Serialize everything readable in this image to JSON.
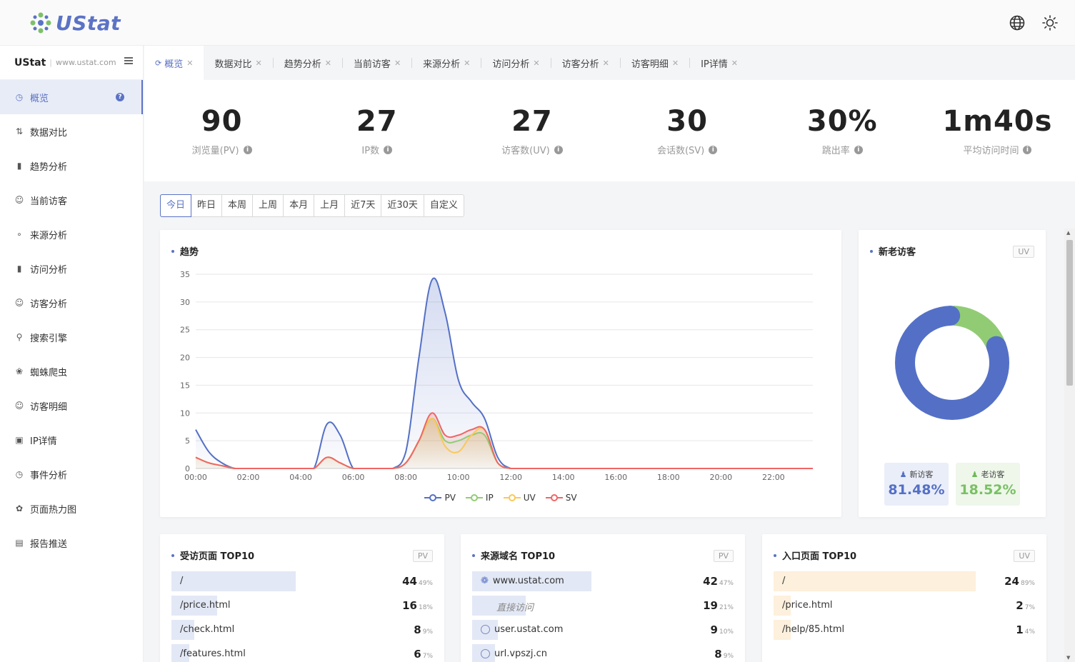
{
  "app": {
    "logo_text": "UStat"
  },
  "site": {
    "name": "UStat",
    "url": "www.ustat.com"
  },
  "sidebar": {
    "items": [
      {
        "label": "概览",
        "icon": "dashboard-icon"
      },
      {
        "label": "数据对比",
        "icon": "compare-icon"
      },
      {
        "label": "趋势分析",
        "icon": "trend-icon"
      },
      {
        "label": "当前访客",
        "icon": "user-icon"
      },
      {
        "label": "来源分析",
        "icon": "share-icon"
      },
      {
        "label": "访问分析",
        "icon": "bar-chart-icon"
      },
      {
        "label": "访客分析",
        "icon": "visitor-icon"
      },
      {
        "label": "搜索引擎",
        "icon": "search-icon"
      },
      {
        "label": "蜘蛛爬虫",
        "icon": "bug-icon"
      },
      {
        "label": "访客明细",
        "icon": "person-detail-icon"
      },
      {
        "label": "IP详情",
        "icon": "ip-icon"
      },
      {
        "label": "事件分析",
        "icon": "clock-icon"
      },
      {
        "label": "页面热力图",
        "icon": "heatmap-icon"
      },
      {
        "label": "报告推送",
        "icon": "report-icon"
      }
    ]
  },
  "tabs": [
    {
      "label": "概览"
    },
    {
      "label": "数据对比"
    },
    {
      "label": "趋势分析"
    },
    {
      "label": "当前访客"
    },
    {
      "label": "来源分析"
    },
    {
      "label": "访问分析"
    },
    {
      "label": "访客分析"
    },
    {
      "label": "访客明细"
    },
    {
      "label": "IP详情"
    }
  ],
  "stats": [
    {
      "value": "90",
      "label": "浏览量(PV)"
    },
    {
      "value": "27",
      "label": "IP数"
    },
    {
      "value": "27",
      "label": "访客数(UV)"
    },
    {
      "value": "30",
      "label": "会话数(SV)"
    },
    {
      "value": "30%",
      "label": "跳出率"
    },
    {
      "value": "1m40s",
      "label": "平均访问时间"
    }
  ],
  "date_range": [
    "今日",
    "昨日",
    "本周",
    "上周",
    "本月",
    "上月",
    "近7天",
    "近30天",
    "自定义"
  ],
  "trend": {
    "title": "趋势"
  },
  "visitors": {
    "title": "新老访客",
    "badge": "UV",
    "new_label": "新访客",
    "new_value": "81.48%",
    "old_label": "老访客",
    "old_value": "18.52%",
    "new_fraction": 0.8148,
    "colors": {
      "new": "#5470c6",
      "old": "#91cc75"
    }
  },
  "chart_data": {
    "type": "line",
    "title": "趋势",
    "x_ticks": [
      "00:00",
      "02:00",
      "04:00",
      "06:00",
      "08:00",
      "10:00",
      "12:00",
      "14:00",
      "16:00",
      "18:00",
      "20:00",
      "22:00"
    ],
    "x": [
      "00:00",
      "00:30",
      "01:00",
      "01:30",
      "02:00",
      "02:30",
      "03:00",
      "03:30",
      "04:00",
      "04:30",
      "05:00",
      "05:30",
      "06:00",
      "06:30",
      "07:00",
      "07:30",
      "08:00",
      "08:30",
      "09:00",
      "09:30",
      "10:00",
      "10:30",
      "11:00",
      "11:30",
      "12:00",
      "12:30",
      "13:00",
      "13:30",
      "14:00",
      "14:30",
      "15:00",
      "15:30",
      "16:00",
      "16:30",
      "17:00",
      "17:30",
      "18:00",
      "18:30",
      "19:00",
      "19:30",
      "20:00",
      "20:30",
      "21:00",
      "21:30",
      "22:00",
      "22:30",
      "23:00",
      "23:30"
    ],
    "series": [
      {
        "name": "PV",
        "color": "#5470c6",
        "values": [
          7,
          3,
          1,
          0,
          0,
          0,
          0,
          0,
          0,
          0,
          8,
          6,
          0,
          0,
          0,
          0,
          3,
          20,
          34,
          28,
          16,
          12,
          9,
          2,
          0,
          0,
          0,
          0,
          0,
          0,
          0,
          0,
          0,
          0,
          0,
          0,
          0,
          0,
          0,
          0,
          0,
          0,
          0,
          0,
          0,
          0,
          0,
          0
        ]
      },
      {
        "name": "IP",
        "color": "#91cc75",
        "values": [
          2,
          1,
          0.5,
          0,
          0,
          0,
          0,
          0,
          0,
          0,
          2,
          1,
          0,
          0,
          0,
          0,
          1,
          5,
          9,
          5,
          5,
          6,
          6,
          1,
          0,
          0,
          0,
          0,
          0,
          0,
          0,
          0,
          0,
          0,
          0,
          0,
          0,
          0,
          0,
          0,
          0,
          0,
          0,
          0,
          0,
          0,
          0,
          0
        ]
      },
      {
        "name": "UV",
        "color": "#fac858",
        "values": [
          2,
          1,
          0.5,
          0,
          0,
          0,
          0,
          0,
          0,
          0,
          2,
          1,
          0,
          0,
          0,
          0,
          1,
          5,
          9,
          4,
          3,
          6,
          7,
          1,
          0,
          0,
          0,
          0,
          0,
          0,
          0,
          0,
          0,
          0,
          0,
          0,
          0,
          0,
          0,
          0,
          0,
          0,
          0,
          0,
          0,
          0,
          0,
          0
        ]
      },
      {
        "name": "SV",
        "color": "#ee6666",
        "values": [
          2,
          1,
          0.5,
          0,
          0,
          0,
          0,
          0,
          0,
          0,
          2,
          1,
          0,
          0,
          0,
          0,
          1,
          5,
          10,
          6,
          6,
          7,
          7,
          1,
          0,
          0,
          0,
          0,
          0,
          0,
          0,
          0,
          0,
          0,
          0,
          0,
          0,
          0,
          0,
          0,
          0,
          0,
          0,
          0,
          0,
          0,
          0,
          0
        ]
      }
    ],
    "ylim": [
      0,
      35
    ],
    "y_ticks": [
      0,
      5,
      10,
      15,
      20,
      25,
      30,
      35
    ],
    "grid": true,
    "legend": "bottom"
  },
  "top_pages": {
    "title": "受访页面 TOP10",
    "badge": "PV",
    "rows": [
      {
        "name": "/",
        "value": "44",
        "pct": "49%",
        "fraction": 0.49
      },
      {
        "name": "/price.html",
        "value": "16",
        "pct": "18%",
        "fraction": 0.18
      },
      {
        "name": "/check.html",
        "value": "8",
        "pct": "9%",
        "fraction": 0.09
      },
      {
        "name": "/features.html",
        "value": "6",
        "pct": "7%",
        "fraction": 0.07
      }
    ]
  },
  "top_domains": {
    "title": "来源域名 TOP10",
    "badge": "PV",
    "rows": [
      {
        "name": "www.ustat.com",
        "value": "42",
        "pct": "47%",
        "fraction": 0.47,
        "icon": "ustat-logo-icon"
      },
      {
        "name": "直接访问",
        "value": "19",
        "pct": "21%",
        "fraction": 0.21,
        "icon": ""
      },
      {
        "name": "user.ustat.com",
        "value": "9",
        "pct": "10%",
        "fraction": 0.1,
        "icon": "globe-icon"
      },
      {
        "name": "url.vpszj.cn",
        "value": "8",
        "pct": "9%",
        "fraction": 0.09,
        "icon": "globe-icon"
      }
    ]
  },
  "top_entries": {
    "title": "入口页面 TOP10",
    "badge": "UV",
    "rows": [
      {
        "name": "/",
        "value": "24",
        "pct": "89%",
        "fraction": 0.89
      },
      {
        "name": "/price.html",
        "value": "2",
        "pct": "7%",
        "fraction": 0.07
      },
      {
        "name": "/help/85.html",
        "value": "1",
        "pct": "4%",
        "fraction": 0.04
      }
    ]
  },
  "colors": {
    "accent": "#5b73c5",
    "pages_bar": "#e3e8f6",
    "entries_bar": "#fdf0dc",
    "new_bg": "#eaeef9",
    "old_bg": "#eef7ea"
  }
}
